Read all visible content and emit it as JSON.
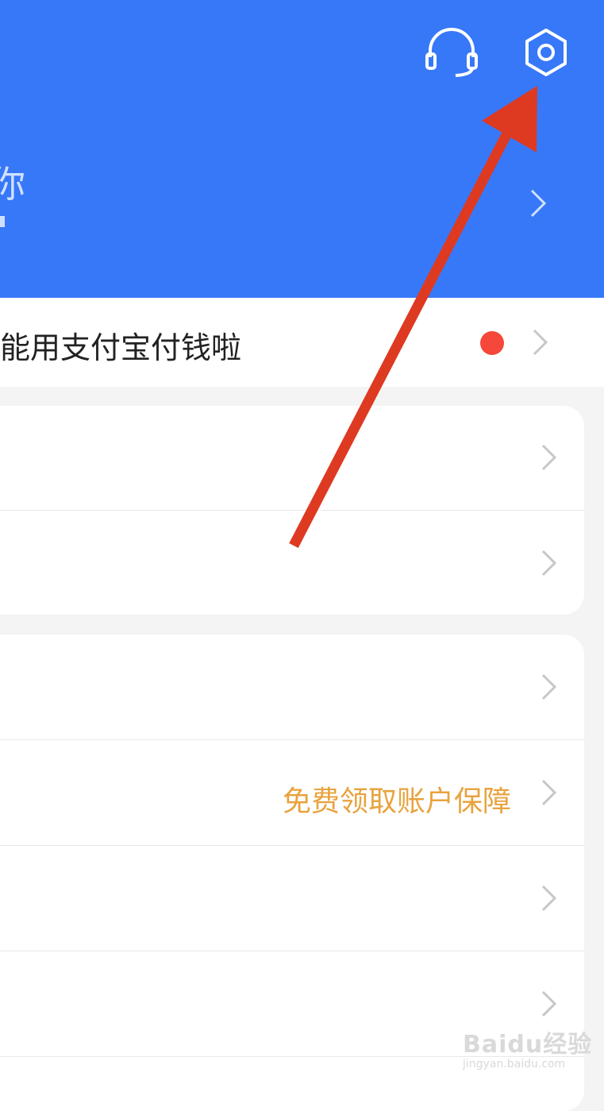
{
  "header": {
    "profile_name": "你",
    "support_icon": "headset-icon",
    "settings_icon": "gear-icon"
  },
  "notice": {
    "text": "能用支付宝付钱啦"
  },
  "cards": {
    "second": {
      "row2_extra": "免费领取账户保障"
    }
  },
  "watermark": {
    "logo": "Baidu经验",
    "sub": "jingyan.baidu.com"
  },
  "colors": {
    "header_bg": "#3778f8",
    "arrow": "#de3a22",
    "accent_orange": "#e8a33e",
    "red_dot": "#f5473a"
  }
}
